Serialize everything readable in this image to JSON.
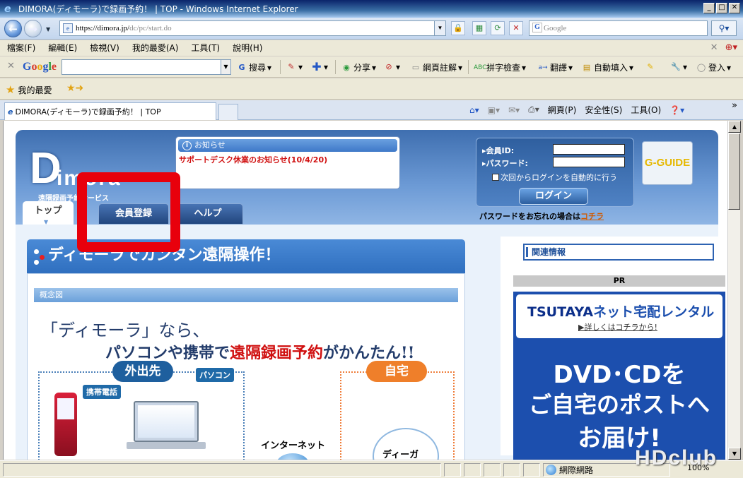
{
  "window": {
    "title": "DIMORA(ディモーラ)で録画予約！ | TOP - Windows Internet Explorer",
    "min": "_",
    "max": "□",
    "close": "✕"
  },
  "address": {
    "url_host": "https://dimora.jp/",
    "url_path": "dc/pc/start.do",
    "search_placeholder": "Google"
  },
  "menu": [
    "檔案(F)",
    "編輯(E)",
    "檢視(V)",
    "我的最愛(A)",
    "工具(T)",
    "說明(H)"
  ],
  "google_toolbar": {
    "logo": [
      "G",
      "o",
      "o",
      "g",
      "l",
      "e"
    ],
    "search_label": "搜尋",
    "share_label": "分享",
    "annotate_label": "網頁註解",
    "spell_label": "拼字檢查",
    "translate_label": "翻譯",
    "autofill_label": "自動填入",
    "signin_label": "登入"
  },
  "favorites": {
    "label": "我的最愛"
  },
  "tabs": [
    {
      "label": "DIMORA(ディモーラ)で録画予約！ | TOP"
    }
  ],
  "command_bar": {
    "page_label": "網頁(P)",
    "safety_label": "安全性(S)",
    "tools_label": "工具(O)",
    "more": "»"
  },
  "site": {
    "logo_main": "D",
    "logo_rest": "imora",
    "logo_sub": "遠隔録画予約サービス",
    "notice": {
      "header": "お知らせ",
      "item": "サポートデスク休業のお知らせ(10/4/20)"
    },
    "login": {
      "id_label": "▸会員ID:",
      "password_label": "▸パスワード:",
      "auto_login_label": "次回からログインを自動的に行う",
      "button": "ログイン",
      "forgot_text": "パスワードをお忘れの場合は",
      "forgot_link": "コチラ"
    },
    "gguide": "G-GUIDE",
    "nav": {
      "top": "トップ",
      "register": "会員登録",
      "help": "ヘルプ"
    },
    "hero": {
      "title": "ディモーラでカンタン遠隔操作！",
      "concept_label": "概念図",
      "lead1": "「ディモーラ」なら、",
      "lead2_pre": "パソコンや携帯で",
      "lead2_em": "遠隔録画予約",
      "lead2_post": "がかんたん!!",
      "outside": "外出先",
      "home": "自宅",
      "mobile": "携帯電話",
      "pc": "パソコン",
      "internet": "インターネット",
      "diga": "ディーガ"
    },
    "side": {
      "related": "関連情報",
      "pr": "PR",
      "ad_brand_a": "TSUTAYA",
      "ad_brand_b": "ネット宅配レンタル",
      "ad_more": "▶詳しくはコチラから!",
      "ad_line1": "DVD･CDを",
      "ad_line2": "ご自宅のポストへ",
      "ad_line3": "お届け!"
    }
  },
  "status": {
    "zone": "網際網路",
    "zoom": "100%",
    "watermark": "HDclub"
  },
  "colors": {
    "highlight_frame": "#e8000c",
    "site_header": "#3f6fb0",
    "notice_text": "#d01010"
  }
}
